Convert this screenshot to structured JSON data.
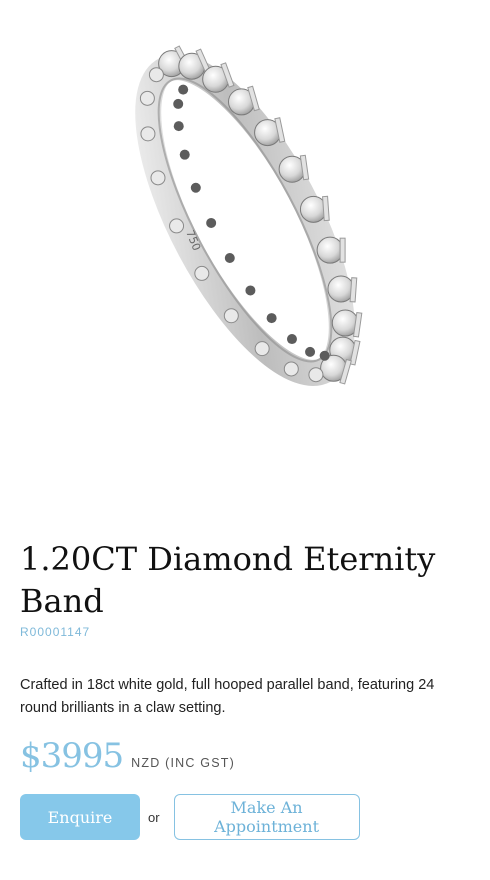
{
  "product": {
    "title": "1.20CT Diamond Eternity Band",
    "sku": "R00001147",
    "description": "Crafted in 18ct white gold, full hooped parallel band, featuring 24 round brilliants in a claw setting.",
    "price": "$3995",
    "currency_note": "NZD (INC GST)",
    "image_alt": "diamond-eternity-band-ring",
    "ring_stamp": "750"
  },
  "actions": {
    "enquire_label": "Enquire",
    "or_text": "or",
    "appointment_label": "Make An Appointment"
  },
  "colors": {
    "accent": "#86c8ea",
    "accent_text": "#6db2d8",
    "sku": "#7fb9d9",
    "text": "#1a1a1a"
  }
}
